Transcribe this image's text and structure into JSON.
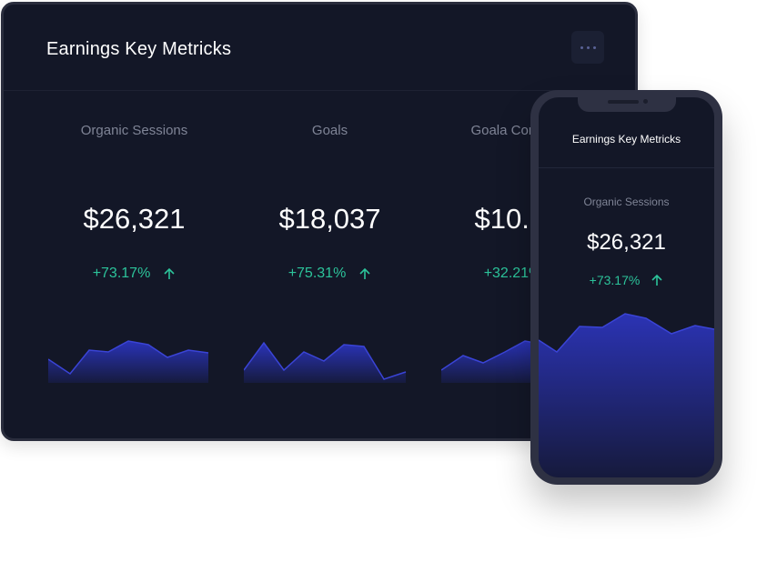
{
  "tablet": {
    "title": "Earnings Key Metricks",
    "more_icon": "more-horizontal-icon",
    "metrics": [
      {
        "label": "Organic Sessions",
        "value": "$26,321",
        "change": "+73.17%",
        "trend_icon": "arrow-up-icon"
      },
      {
        "label": "Goals",
        "value": "$18,037",
        "change": "+75.31%",
        "trend_icon": "arrow-up-icon"
      },
      {
        "label": "Goala Conversion",
        "value": "$10.520",
        "change": "+32.21%",
        "trend_icon": "arrow-up-icon"
      }
    ]
  },
  "phone": {
    "title": "Earnings Key Metricks",
    "metric": {
      "label": "Organic Sessions",
      "value": "$26,321",
      "change": "+73.17%",
      "trend_icon": "arrow-up-icon"
    }
  },
  "colors": {
    "background": "#131727",
    "accent_line": "#3a44d6",
    "positive": "#2cc39a",
    "muted_text": "#7f8496"
  }
}
